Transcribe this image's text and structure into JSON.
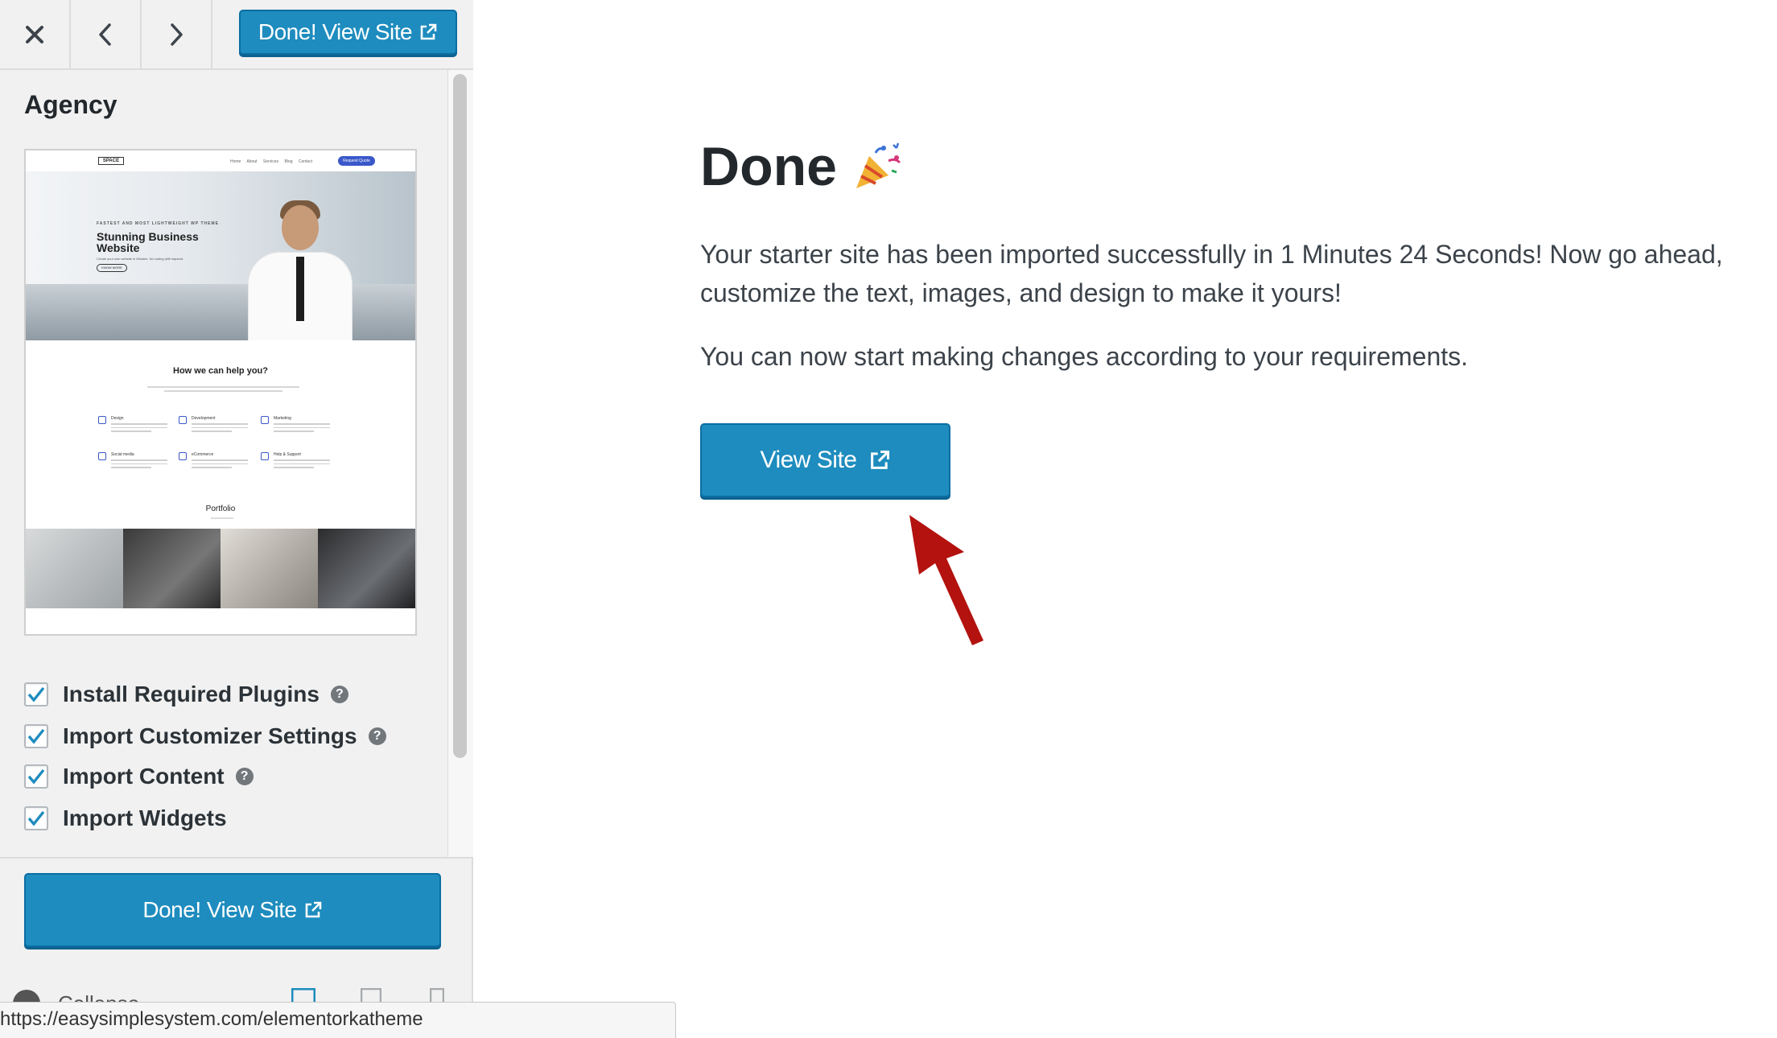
{
  "topbar": {
    "close_icon": "close-icon",
    "prev_icon": "chevron-left-icon",
    "next_icon": "chevron-right-icon",
    "done_button_label": "Done! View Site"
  },
  "sidebar": {
    "theme_title": "Agency",
    "preview": {
      "logo": "SPACE",
      "nav_links": "Home About Services Blog Contact",
      "nav_cta": "Request Quote",
      "kicker": "FASTEST AND MOST LIGHTWEIGHT WP THEME",
      "headline": "Stunning Business Website",
      "subline": "Create your own website in Minutes. No coding skill required.",
      "more_button": "KNOW MORE",
      "section_heading": "How we can help you?",
      "features": [
        "Design",
        "Development",
        "Marketing",
        "Social media",
        "eCommerce",
        "Help & Support"
      ],
      "portfolio_heading": "Portfolio"
    },
    "checklist": [
      {
        "label": "Install Required Plugins",
        "checked": true,
        "has_help": true
      },
      {
        "label": "Import Customizer Settings",
        "checked": true,
        "has_help": true
      },
      {
        "label": "Import Content",
        "checked": true,
        "has_help": true
      },
      {
        "label": "Import Widgets",
        "checked": true,
        "has_help": false
      }
    ],
    "help_glyph": "?",
    "bottom_done_label": "Done! View Site",
    "collapse_label": "Collapse"
  },
  "status_url": "https://easysimplesystem.com/elementorkatheme",
  "main": {
    "title": "Done",
    "title_emoji": "party-popper-icon",
    "paragraph1": "Your starter site has been imported successfully in 1 Minutes 24 Seconds! Now go ahead, customize the text, images, and design to make it yours!",
    "paragraph2": "You can now start making changes according to your requirements.",
    "view_site_label": "View Site"
  },
  "colors": {
    "primary_button": "#1e8cbe",
    "checkmark": "#1e8cbe",
    "annotation_arrow": "#b3120f",
    "sidebar_bg": "#f1f1f1"
  }
}
